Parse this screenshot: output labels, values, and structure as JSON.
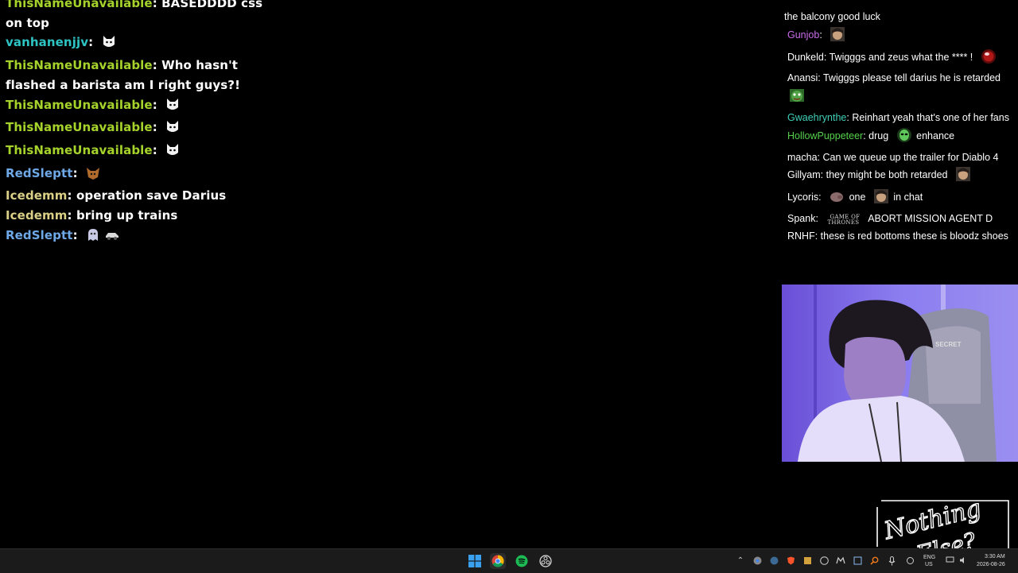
{
  "colors": {
    "green_user": "#a6d32b",
    "teal_user": "#2ec4c4",
    "blue_user": "#6ea8e6",
    "khaki_user": "#d9cf87",
    "taskbar_bg": "#1b1b1b"
  },
  "left_chat": [
    {
      "user": "ThisNameUnavailable",
      "text": "BASEDDDD css on top",
      "color": "#a6d32b",
      "emotes": []
    },
    {
      "user": "vanhanenjjv",
      "text": "",
      "color": "#2ec4c4",
      "emotes": [
        "cat-emote"
      ]
    },
    {
      "user": "ThisNameUnavailable",
      "text": "Who hasn't flashed a barista am I right guys?!",
      "color": "#a6d32b",
      "emotes": []
    },
    {
      "user": "ThisNameUnavailable",
      "text": "",
      "color": "#a6d32b",
      "emotes": [
        "cat-emote"
      ]
    },
    {
      "user": "ThisNameUnavailable",
      "text": "",
      "color": "#a6d32b",
      "emotes": [
        "cat-emote"
      ]
    },
    {
      "user": "ThisNameUnavailable",
      "text": "",
      "color": "#a6d32b",
      "emotes": [
        "cat-emote"
      ]
    },
    {
      "user": "RedSleptt",
      "text": "",
      "color": "#6ea8e6",
      "emotes": [
        "fox-emote"
      ]
    },
    {
      "user": "Icedemm",
      "text": "operation save Darius",
      "color": "#d9cf87",
      "emotes": []
    },
    {
      "user": "Icedemm",
      "text": "bring up trains",
      "color": "#d9cf87",
      "emotes": []
    },
    {
      "user": "RedSleptt",
      "text": "",
      "color": "#6ea8e6",
      "emotes": [
        "ghost-emote",
        "car-emote"
      ]
    }
  ],
  "right_chat": {
    "top_partial": "the balcony good luck",
    "messages": [
      {
        "user": "Gunjob",
        "user_color": "#c86ce8",
        "parts": [
          {
            "emote": "face-emote"
          }
        ]
      },
      {
        "user": "Dunkeld",
        "user_color": "#ffffff",
        "parts": [
          {
            "text": "Twigggs and zeus what the **** !"
          },
          {
            "emote": "ball-emote"
          }
        ]
      },
      {
        "user": "Anansi",
        "user_color": "#ffffff",
        "parts": [
          {
            "text": "Twigggs please tell darius he is retarded"
          },
          {
            "emote": "pepe-emote"
          }
        ]
      },
      {
        "user": "Gwaehrynthe",
        "user_color": "#3fd0b8",
        "parts": [
          {
            "text": "Reinhart yeah that's one of her fans"
          }
        ]
      },
      {
        "user": "HollowPuppeteer",
        "user_color": "#54d14b",
        "parts": [
          {
            "text": "drug"
          },
          {
            "emote": "alien-emote"
          },
          {
            "text": "enhance"
          }
        ]
      },
      {
        "user": "macha",
        "user_color": "#ffffff",
        "parts": [
          {
            "text": "Can we queue up the trailer for Diablo 4"
          }
        ]
      },
      {
        "user": "Gillyam",
        "user_color": "#ffffff",
        "parts": [
          {
            "text": "they might be both retarded"
          },
          {
            "emote": "face-emote"
          }
        ]
      },
      {
        "user": "Lycoris",
        "user_color": "#ffffff",
        "parts": [
          {
            "emote": "pig-emote"
          },
          {
            "text": "one"
          },
          {
            "emote": "face-emote"
          },
          {
            "text": "in chat"
          }
        ]
      },
      {
        "user": "Spank",
        "user_color": "#ffffff",
        "parts": [
          {
            "emote": "got-logo-emote",
            "label": "GAME OF THRONES"
          },
          {
            "text": "ABORT MISSION AGENT D"
          }
        ]
      },
      {
        "user": "RNHF",
        "user_color": "#ffffff",
        "parts": [
          {
            "text": "these is red bottoms these is bloodz shoes"
          }
        ]
      }
    ]
  },
  "webcam": {
    "chair_brand": "SECRET"
  },
  "logo": {
    "line1": "Nothing",
    "line2": "Else?"
  },
  "taskbar": {
    "apps": [
      "windows-start-icon",
      "chrome-icon",
      "spotify-icon",
      "obs-icon"
    ],
    "language": "ENG",
    "region": "US",
    "time": "3:30 AM",
    "date": "2026-08-26"
  }
}
